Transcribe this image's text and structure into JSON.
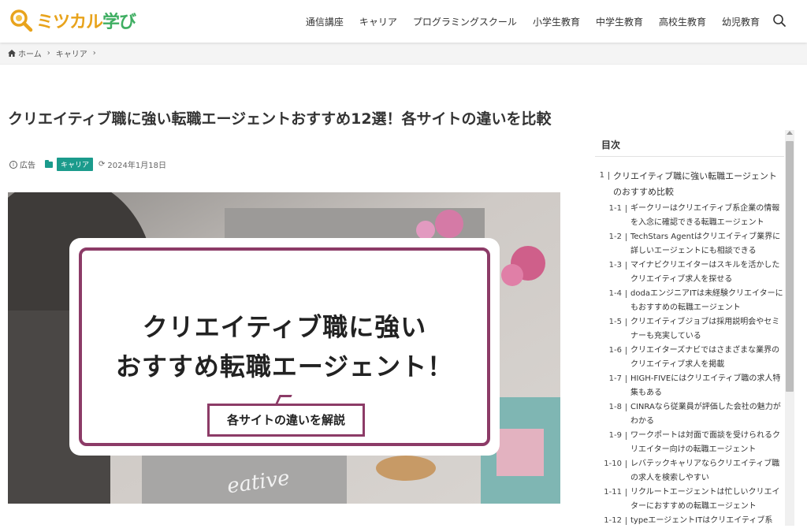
{
  "site": {
    "logo_text_a": "ミツカル",
    "logo_text_b": "学び",
    "accent": "#e8a31c",
    "brand_green": "#3fae62",
    "category_color": "#1b9b8c",
    "frame_color": "#8c3b67"
  },
  "nav": {
    "items": [
      "通信講座",
      "キャリア",
      "プログラミングスクール",
      "小学生教育",
      "中学生教育",
      "高校生教育",
      "幼児教育"
    ],
    "search_icon": "search-icon"
  },
  "breadcrumb": {
    "home": "ホーム",
    "category": "キャリア"
  },
  "article": {
    "title": "クリエイティブ職に強い転職エージェントおすすめ12選！各サイトの違いを比較",
    "ad_label": "広告",
    "category": "キャリア",
    "date": "2024年1月18日"
  },
  "hero": {
    "line1": "クリエイティブ職に強い",
    "line2": "おすすめ転職エージェント！",
    "bubble": "各サイトの違いを解説",
    "bg_text": "eative"
  },
  "toc": {
    "title": "目次",
    "items": [
      {
        "num": "1",
        "level": 1,
        "text": "クリエイティブ職に強い転職エージェントのおすすめ比較"
      },
      {
        "num": "1-1",
        "level": 2,
        "text": "ギークリーはクリエイティブ系企業の情報を入念に確認できる転職エージェント"
      },
      {
        "num": "1-2",
        "level": 2,
        "text": "TechStars Agentはクリエイティブ業界に詳しいエージェントにも相談できる"
      },
      {
        "num": "1-3",
        "level": 2,
        "text": "マイナビクリエイターはスキルを活かしたクリエイティブ求人を探せる"
      },
      {
        "num": "1-4",
        "level": 2,
        "text": "dodaエンジニアITは未経験クリエイターにもおすすめの転職エージェント"
      },
      {
        "num": "1-5",
        "level": 2,
        "text": "クリエイティブジョブは採用説明会やセミナーも充実している"
      },
      {
        "num": "1-6",
        "level": 2,
        "text": "クリエイターズナビではさまざまな業界のクリエイティブ求人を掲載"
      },
      {
        "num": "1-7",
        "level": 2,
        "text": "HIGH-FIVEにはクリエイティブ職の求人特集もある"
      },
      {
        "num": "1-8",
        "level": 2,
        "text": "CINRAなら従業員が評価した会社の魅力がわかる"
      },
      {
        "num": "1-9",
        "level": 2,
        "text": "ワークポートは対面で面談を受けられるクリエイター向けの転職エージェント"
      },
      {
        "num": "1-10",
        "level": 2,
        "text": "レバテックキャリアならクリエイティブ職の求人を検索しやすい"
      },
      {
        "num": "1-11",
        "level": 2,
        "text": "リクルートエージェントは忙しいクリエイターにおすすめの転職エージェント"
      },
      {
        "num": "1-12",
        "level": 2,
        "text": "typeエージェントITはクリエイティブ系"
      }
    ]
  }
}
